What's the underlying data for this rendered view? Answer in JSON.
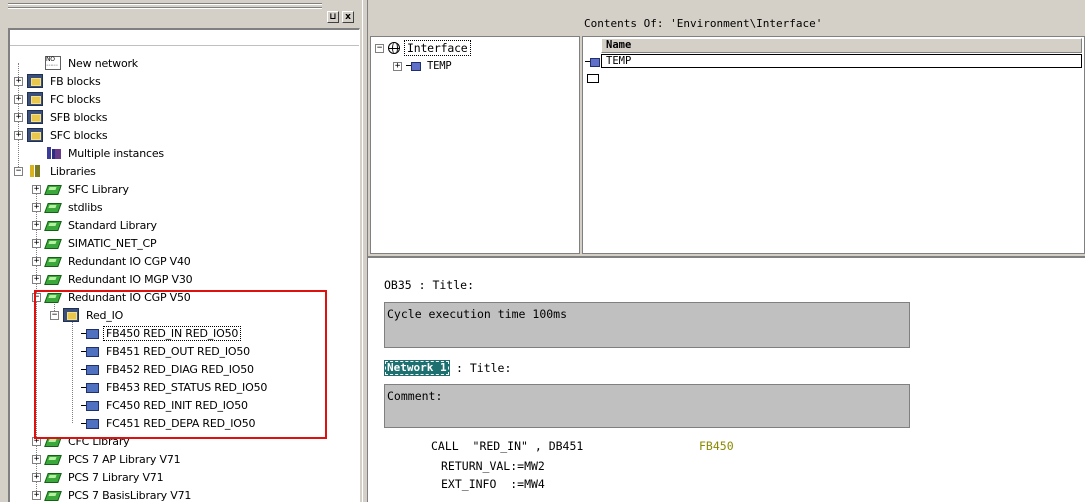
{
  "left_pane": {
    "controls": {
      "restore": "⊔",
      "close": "x"
    },
    "tree": [
      {
        "label": "New network",
        "icon": "network-icon",
        "expander": ""
      },
      {
        "label": "FB blocks",
        "icon": "block-folder-icon",
        "expander": "+"
      },
      {
        "label": "FC blocks",
        "icon": "block-folder-icon",
        "expander": "+"
      },
      {
        "label": "SFB blocks",
        "icon": "block-folder-icon",
        "expander": "+"
      },
      {
        "label": "SFC blocks",
        "icon": "block-folder-icon",
        "expander": "+"
      },
      {
        "label": "Multiple instances",
        "icon": "multi-instance-icon",
        "expander": ""
      },
      {
        "label": "Libraries",
        "icon": "libraries-icon",
        "expander": "−"
      },
      {
        "label": "SFC Library",
        "icon": "library-book-icon",
        "expander": "+"
      },
      {
        "label": "stdlibs",
        "icon": "library-book-icon",
        "expander": "+"
      },
      {
        "label": "Standard Library",
        "icon": "library-book-icon",
        "expander": "+"
      },
      {
        "label": "SIMATIC_NET_CP",
        "icon": "library-book-icon",
        "expander": "+"
      },
      {
        "label": "Redundant IO CGP V40",
        "icon": "library-book-icon",
        "expander": "+"
      },
      {
        "label": "Redundant IO MGP V30",
        "icon": "library-book-icon",
        "expander": "+"
      },
      {
        "label": "Redundant IO CGP V50",
        "icon": "library-book-icon",
        "expander": "−"
      },
      {
        "label": "Red_IO",
        "icon": "block-folder-icon",
        "expander": "−"
      },
      {
        "label": "FB450  RED_IN  RED_IO50",
        "icon": "function-block-icon",
        "expander": ""
      },
      {
        "label": "FB451  RED_OUT  RED_IO50",
        "icon": "function-block-icon",
        "expander": ""
      },
      {
        "label": "FB452  RED_DIAG  RED_IO50",
        "icon": "function-block-icon",
        "expander": ""
      },
      {
        "label": "FB453  RED_STATUS  RED_IO50",
        "icon": "function-block-icon",
        "expander": ""
      },
      {
        "label": "FC450  RED_INIT  RED_IO50",
        "icon": "function-block-icon",
        "expander": ""
      },
      {
        "label": "FC451  RED_DEPA  RED_IO50",
        "icon": "function-block-icon",
        "expander": ""
      },
      {
        "label": "CFC Library",
        "icon": "library-book-icon",
        "expander": "+"
      },
      {
        "label": "PCS 7 AP Library V71",
        "icon": "library-book-icon",
        "expander": "+"
      },
      {
        "label": "PCS 7 Library V71",
        "icon": "library-book-icon",
        "expander": "+"
      },
      {
        "label": "PCS 7 BasisLibrary V71",
        "icon": "library-book-icon",
        "expander": "+"
      }
    ],
    "highlight_color": "#e01010"
  },
  "interface_tree": {
    "root": {
      "label": "Interface",
      "expander": "−"
    },
    "child": {
      "label": "TEMP",
      "expander": "+"
    }
  },
  "contents": {
    "title": "Contents Of: 'Environment\\Interface'",
    "column_header": "Name",
    "rows": [
      "TEMP"
    ]
  },
  "editor": {
    "block_title": "OB35 : Title:",
    "block_comment": "Cycle execution time 100ms",
    "network_tag": "Network 1",
    "network_title": ": Title:",
    "network_comment_label": "Comment:",
    "code": {
      "call_line": "CALL  \"RED_IN\" , DB451",
      "call_ref": "FB450",
      "param1": "RETURN_VAL:=MW2",
      "param2": "EXT_INFO  :=MW4"
    },
    "ref_color": "#8a8a00",
    "network_tag_color": "#1e6f6f"
  }
}
